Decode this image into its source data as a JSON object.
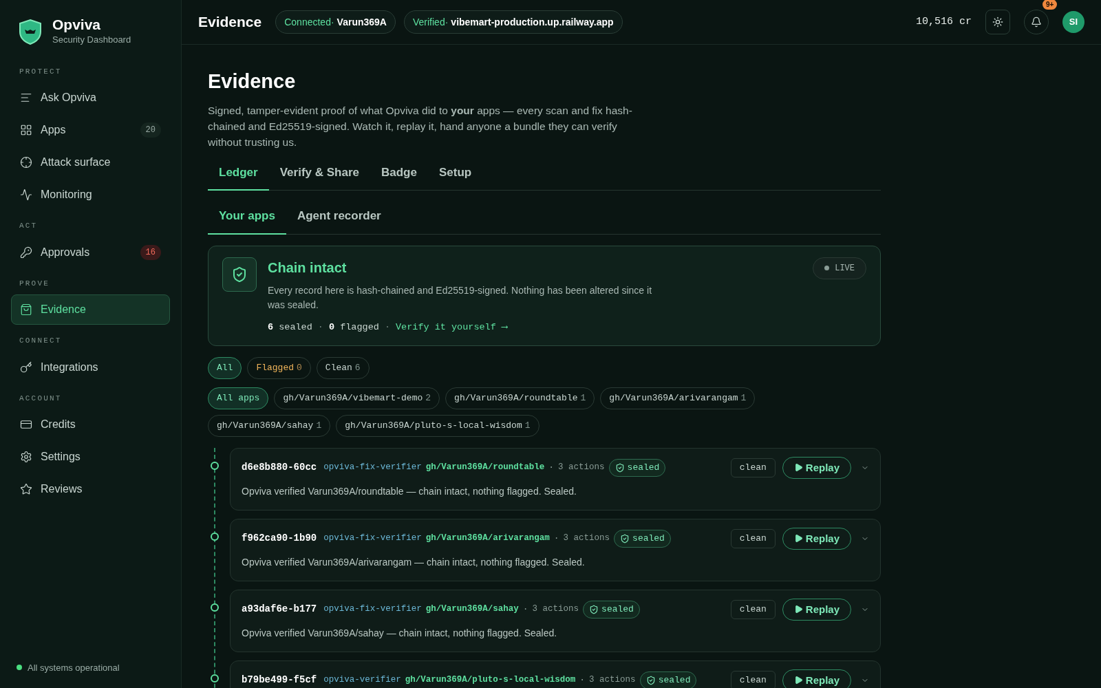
{
  "sidebar": {
    "brand": {
      "name": "Opviva",
      "subtitle": "Security Dashboard"
    },
    "sections": [
      {
        "label": "PROTECT",
        "items": [
          {
            "label": "Ask Opviva",
            "selected": false
          },
          {
            "label": "Apps",
            "selected": false,
            "badge": {
              "text": "20",
              "kind": "neutral"
            }
          },
          {
            "label": "Attack surface",
            "selected": false
          },
          {
            "label": "Monitoring",
            "selected": false
          }
        ]
      },
      {
        "label": "ACT",
        "items": [
          {
            "label": "Approvals",
            "selected": false,
            "badge": {
              "text": "16",
              "kind": "alert"
            }
          }
        ]
      },
      {
        "label": "PROVE",
        "items": [
          {
            "label": "Evidence",
            "selected": true
          }
        ]
      },
      {
        "label": "CONNECT",
        "items": [
          {
            "label": "Integrations",
            "selected": false
          }
        ]
      },
      {
        "label": "ACCOUNT",
        "items": [
          {
            "label": "Credits",
            "selected": false
          },
          {
            "label": "Settings",
            "selected": false
          },
          {
            "label": "Reviews",
            "selected": false
          }
        ]
      }
    ],
    "status": {
      "text": "All systems operational",
      "color": "#4ade80"
    }
  },
  "topbar": {
    "title": "Evidence",
    "chips": [
      {
        "label": "Connected·",
        "value": "Varun369A"
      },
      {
        "label": "Verified·",
        "value": "vibemart-production.up.railway.app"
      }
    ],
    "credits": "10,516 cr",
    "notification_badge": "9+",
    "avatar": "SI"
  },
  "page": {
    "title": "Evidence",
    "description": "Signed, tamper-evident proof of what Opviva did to **your** apps — every scan and fix hash-chained and Ed25519-signed. Watch it, replay it, hand anyone a bundle they can verify without trusting us.",
    "tabs": [
      {
        "label": "Ledger",
        "selected": true
      },
      {
        "label": "Verify & Share",
        "selected": false
      },
      {
        "label": "Badge",
        "selected": false
      },
      {
        "label": "Setup",
        "selected": false
      }
    ],
    "subtabs": [
      {
        "label": "Your apps",
        "selected": true
      },
      {
        "label": "Agent recorder",
        "selected": false
      }
    ],
    "summary": {
      "title": "Chain intact",
      "text": "Every record here is hash-chained and Ed25519-signed. Nothing has been altered since it was sealed.",
      "sealed_count": "6",
      "sealed_label": "sealed",
      "flagged_count": "0",
      "flagged_label": "flagged",
      "separator": "·",
      "link": "Verify it yourself ⟶",
      "live": "LIVE"
    },
    "status_filters": [
      {
        "label": "All",
        "selected": true,
        "kind": "all"
      },
      {
        "label": "Flagged",
        "count": "0",
        "selected": false,
        "kind": "flagged"
      },
      {
        "label": "Clean",
        "count": "6",
        "selected": false,
        "kind": "clean"
      }
    ],
    "app_filters": [
      {
        "label": "All apps",
        "selected": true
      },
      {
        "label": "gh/Varun369A/vibemart-demo",
        "count": "2",
        "selected": false
      },
      {
        "label": "gh/Varun369A/roundtable",
        "count": "1",
        "selected": false
      },
      {
        "label": "gh/Varun369A/arivarangam",
        "count": "1",
        "selected": false
      },
      {
        "label": "gh/Varun369A/sahay",
        "count": "1",
        "selected": false
      },
      {
        "label": "gh/Varun369A/pluto-s-local-wisdom",
        "count": "1",
        "selected": false
      }
    ],
    "records": [
      {
        "id": "d6e8b880-60cc",
        "agent": "opviva-fix-verifier",
        "repo": "gh/Varun369A/roundtable",
        "sep": "·",
        "actions": "3 actions",
        "seal": "sealed",
        "verdict": "clean",
        "replay": "Replay",
        "message": "Opviva verified Varun369A/roundtable — chain intact, nothing flagged. Sealed."
      },
      {
        "id": "f962ca90-1b90",
        "agent": "opviva-fix-verifier",
        "repo": "gh/Varun369A/arivarangam",
        "sep": "·",
        "actions": "3 actions",
        "seal": "sealed",
        "verdict": "clean",
        "replay": "Replay",
        "message": "Opviva verified Varun369A/arivarangam — chain intact, nothing flagged. Sealed."
      },
      {
        "id": "a93daf6e-b177",
        "agent": "opviva-fix-verifier",
        "repo": "gh/Varun369A/sahay",
        "sep": "·",
        "actions": "3 actions",
        "seal": "sealed",
        "verdict": "clean",
        "replay": "Replay",
        "message": "Opviva verified Varun369A/sahay — chain intact, nothing flagged. Sealed."
      },
      {
        "id": "b79be499-f5cf",
        "agent": "opviva-verifier",
        "repo": "gh/Varun369A/pluto-s-local-wisdom",
        "sep": "·",
        "actions": "3 actions",
        "seal": "sealed",
        "verdict": "clean",
        "replay": "Replay"
      }
    ]
  }
}
